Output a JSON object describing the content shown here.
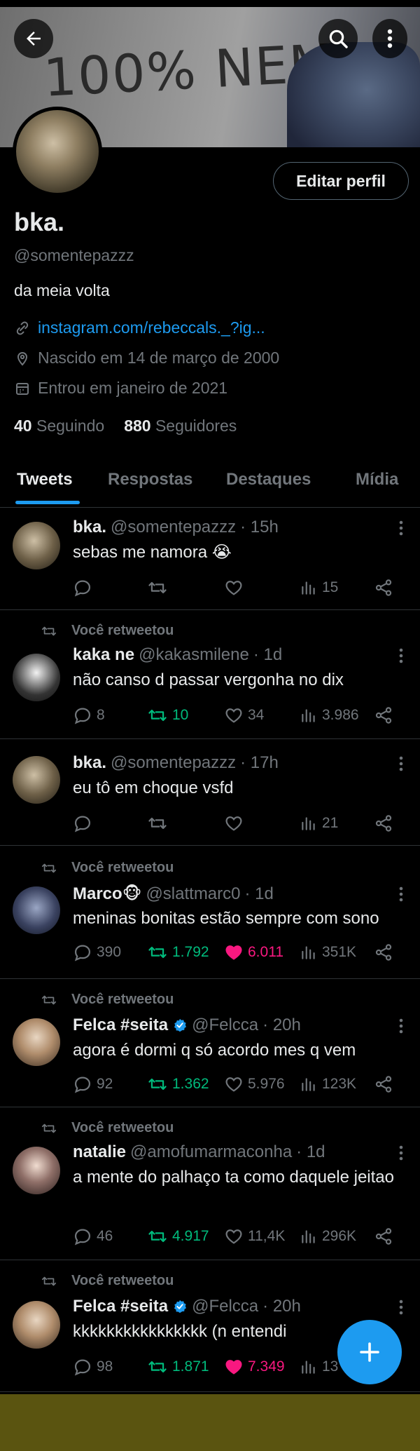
{
  "profile": {
    "name": "bka.",
    "handle": "@somentepazzz",
    "bio": "da meia volta",
    "link": "instagram.com/rebeccals._?ig...",
    "birth": "Nascido em 14 de março de 2000",
    "joined": "Entrou em janeiro de 2021",
    "following_count": "40",
    "following_label": "Seguindo",
    "followers_count": "880",
    "followers_label": "Seguidores",
    "edit_label": "Editar perfil",
    "banner_text": "100% NEM"
  },
  "tabs": [
    "Tweets",
    "Respostas",
    "Destaques",
    "Mídia"
  ],
  "tweets": [
    {
      "retweet": "",
      "name": "bka.",
      "handle": "@somentepazzz",
      "time": "· 15h",
      "text": "sebas me namora 😭",
      "replies": "",
      "retweets": "",
      "likes": "",
      "views": "15",
      "rt_active": false,
      "like_active": false
    },
    {
      "retweet": "Você retweetou",
      "name": "kaka ne",
      "handle": "@kakasmilene",
      "time": "· 1d",
      "text": "não canso d passar vergonha no dix",
      "replies": "8",
      "retweets": "10",
      "likes": "34",
      "views": "3.986",
      "rt_active": true,
      "like_active": false
    },
    {
      "retweet": "",
      "name": "bka.",
      "handle": "@somentepazzz",
      "time": "· 17h",
      "text": "eu tô em choque vsfd",
      "replies": "",
      "retweets": "",
      "likes": "",
      "views": "21",
      "rt_active": false,
      "like_active": false
    },
    {
      "retweet": "Você retweetou",
      "name": "Marco🐵",
      "handle": "@slattmarc0",
      "time": "· 1d",
      "text": "meninas bonitas estão sempre com sono",
      "replies": "390",
      "retweets": "1.792",
      "likes": "6.011",
      "views": "351K",
      "rt_active": true,
      "like_active": true
    },
    {
      "retweet": "Você retweetou",
      "name": "Felca #seita",
      "handle": "@Felcca",
      "time": "· 20h",
      "text": "agora é dormi q só acordo mes q vem",
      "replies": "92",
      "retweets": "1.362",
      "likes": "5.976",
      "views": "123K",
      "rt_active": true,
      "like_active": false,
      "verified": true
    },
    {
      "retweet": "Você retweetou",
      "name": "natalie",
      "handle": "@amofumarmaconha",
      "time": "· 1d",
      "text": "a mente do palhaço ta como daquele jeitao",
      "replies": "46",
      "retweets": "4.917",
      "likes": "11,4K",
      "views": "296K",
      "rt_active": true,
      "like_active": false
    },
    {
      "retweet": "Você retweetou",
      "name": "Felca #seita",
      "handle": "@Felcca",
      "time": "· 20h",
      "text": "kkkkkkkkkkkkkkkk (n entendi",
      "replies": "98",
      "retweets": "1.871",
      "likes": "7.349",
      "views": "13",
      "rt_active": true,
      "like_active": true,
      "verified": true
    }
  ],
  "colors": {
    "accent": "#1d9bf0",
    "retweet": "#00ba7c",
    "like": "#f91880",
    "muted": "#71767b"
  }
}
